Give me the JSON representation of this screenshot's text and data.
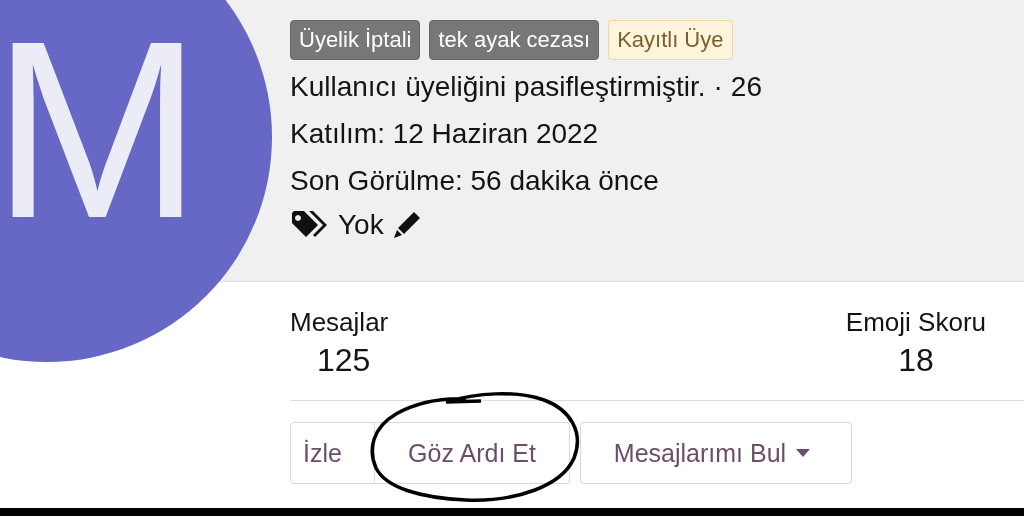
{
  "avatar": {
    "letter": "M"
  },
  "banners": [
    {
      "text": "Üyelik İptali",
      "kind": "dark"
    },
    {
      "text": "tek ayak cezası",
      "kind": "dark"
    },
    {
      "text": "Kayıtlı Üye",
      "kind": "light"
    }
  ],
  "status_line": {
    "text": "Kullanıcı üyeliğini pasifleştirmiştir.",
    "separator": "·",
    "count": "26"
  },
  "joined": "Katılım: 12 Haziran 2022",
  "last_seen": "Son Görülme: 56 dakika önce",
  "tags": {
    "text": "Yok"
  },
  "stats": [
    {
      "label": "Mesajlar",
      "value": "125"
    },
    {
      "label": "Emoji Skoru",
      "value": "18"
    }
  ],
  "buttons": [
    {
      "label": "İzle",
      "kind": "grouped",
      "dropdown": false
    },
    {
      "label": "Göz Ardı Et",
      "kind": "grouped",
      "dropdown": false
    },
    {
      "label": "Mesajlarımı Bul",
      "kind": "single",
      "dropdown": true
    }
  ]
}
